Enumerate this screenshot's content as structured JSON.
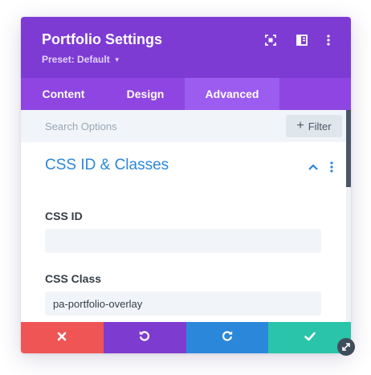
{
  "modal": {
    "title": "Portfolio Settings",
    "preset_label": "Preset: Default",
    "header_icons": [
      "fullscreen-icon",
      "split-view-icon",
      "more-options-icon"
    ]
  },
  "tabs": [
    {
      "label": "Content",
      "active": false
    },
    {
      "label": "Design",
      "active": false
    },
    {
      "label": "Advanced",
      "active": true
    }
  ],
  "search": {
    "placeholder": "Search Options",
    "value": "",
    "filter_label": "Filter"
  },
  "section": {
    "title": "CSS ID & Classes",
    "expanded": true,
    "fields": [
      {
        "label": "CSS ID",
        "value": ""
      },
      {
        "label": "CSS Class",
        "value": "pa-portfolio-overlay"
      }
    ]
  },
  "footer": {
    "buttons": [
      {
        "name": "discard",
        "icon": "close-icon",
        "color": "#ef5555"
      },
      {
        "name": "undo",
        "icon": "undo-icon",
        "color": "#7e3bd0"
      },
      {
        "name": "redo",
        "icon": "redo-icon",
        "color": "#2b87da"
      },
      {
        "name": "save",
        "icon": "check-icon",
        "color": "#29c4a9"
      }
    ]
  },
  "colors": {
    "header": "#7d3bd4",
    "tabs": "#8e45e1",
    "tab_active": "#9c5cf0",
    "section_title": "#2b87da"
  }
}
